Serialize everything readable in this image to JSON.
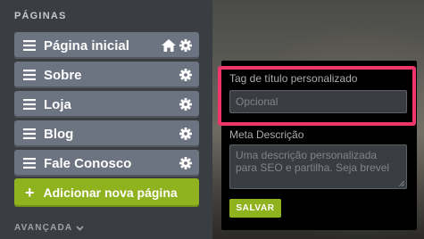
{
  "sidebar": {
    "section_title": "PÁGINAS",
    "pages": [
      {
        "label": "Página inicial"
      },
      {
        "label": "Sobre"
      },
      {
        "label": "Loja"
      },
      {
        "label": "Blog"
      },
      {
        "label": "Fale Conosco"
      }
    ],
    "add_page_label": "Adicionar nova página",
    "add_page_icon": "+",
    "advanced_label": "AVANÇADA"
  },
  "panel": {
    "title_tag_label": "Tag de título personalizado",
    "title_tag_placeholder": "Opcional",
    "meta_label": "Meta Descrição",
    "meta_placeholder": "Uma descrição personalizada para SEO e partilha. Seja brevel",
    "save_label": "SALVAR"
  },
  "colors": {
    "sidebar_bg": "#3a3d42",
    "page_item_bg": "#6c7381",
    "accent_green": "#8fb21f",
    "highlight_pink": "#f0356b",
    "panel_bg": "#000000"
  },
  "icons": {
    "drag_handle": "menu-icon",
    "home": "home-icon",
    "settings": "gear-icon",
    "advanced_toggle": "chevron-down-icon"
  }
}
